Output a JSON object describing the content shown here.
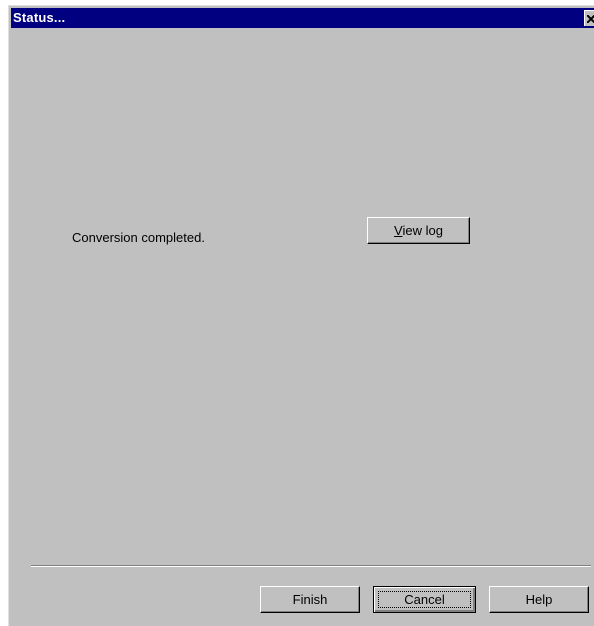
{
  "window": {
    "title": "Status...",
    "close_glyph": "×"
  },
  "body": {
    "message": "Conversion completed.",
    "view_log": {
      "accel": "V",
      "rest": "iew log"
    }
  },
  "footer": {
    "finish_label": "Finish",
    "cancel_label": "Cancel",
    "help_label": "Help"
  },
  "colors": {
    "titlebar": "#000080",
    "face": "#c0c0c0"
  },
  "icons": {
    "close": "close-icon"
  }
}
